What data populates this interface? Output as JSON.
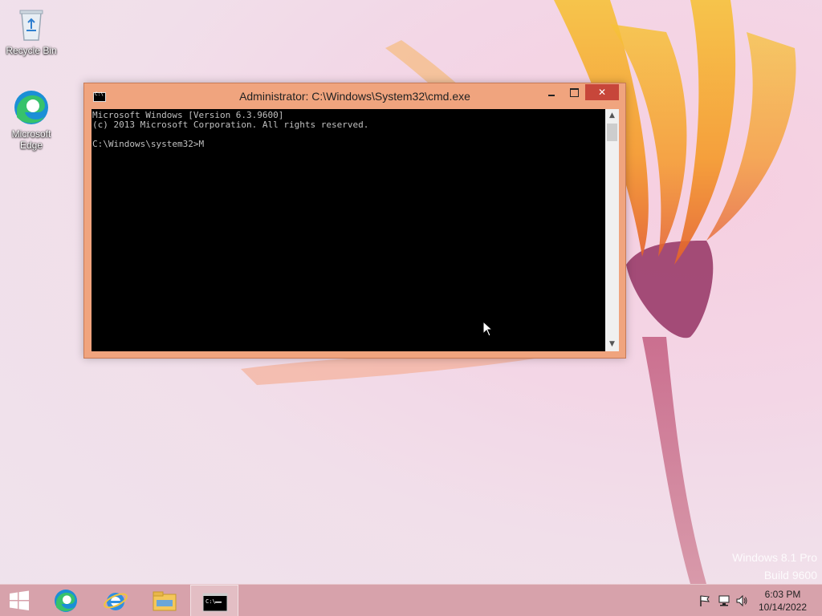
{
  "desktop": {
    "icons": [
      {
        "label": "Recycle Bin",
        "icon": "recycle-bin-icon"
      },
      {
        "label": "Microsoft Edge",
        "icon": "edge-icon"
      }
    ]
  },
  "window": {
    "title": "Administrator: C:\\Windows\\System32\\cmd.exe",
    "icon": "cmd-icon",
    "console_lines": [
      "Microsoft Windows [Version 6.3.9600]",
      "(c) 2013 Microsoft Corporation. All rights reserved.",
      "",
      "C:\\Windows\\system32>M"
    ],
    "close_glyph": "✕"
  },
  "watermark": {
    "line1": "Windows 8.1 Pro",
    "line2": "Build 9600"
  },
  "taskbar": {
    "items": [
      {
        "icon": "start-icon"
      },
      {
        "icon": "edge-icon"
      },
      {
        "icon": "internet-explorer-icon"
      },
      {
        "icon": "file-explorer-icon"
      },
      {
        "icon": "cmd-icon",
        "active": true
      }
    ],
    "tray": {
      "icons": [
        "flag-icon",
        "network-icon",
        "volume-icon"
      ],
      "time": "6:03 PM",
      "date": "10/14/2022"
    }
  },
  "colors": {
    "titlebar": "#f0a47e",
    "close_button": "#c7463a",
    "taskbar": "#d296a0"
  }
}
